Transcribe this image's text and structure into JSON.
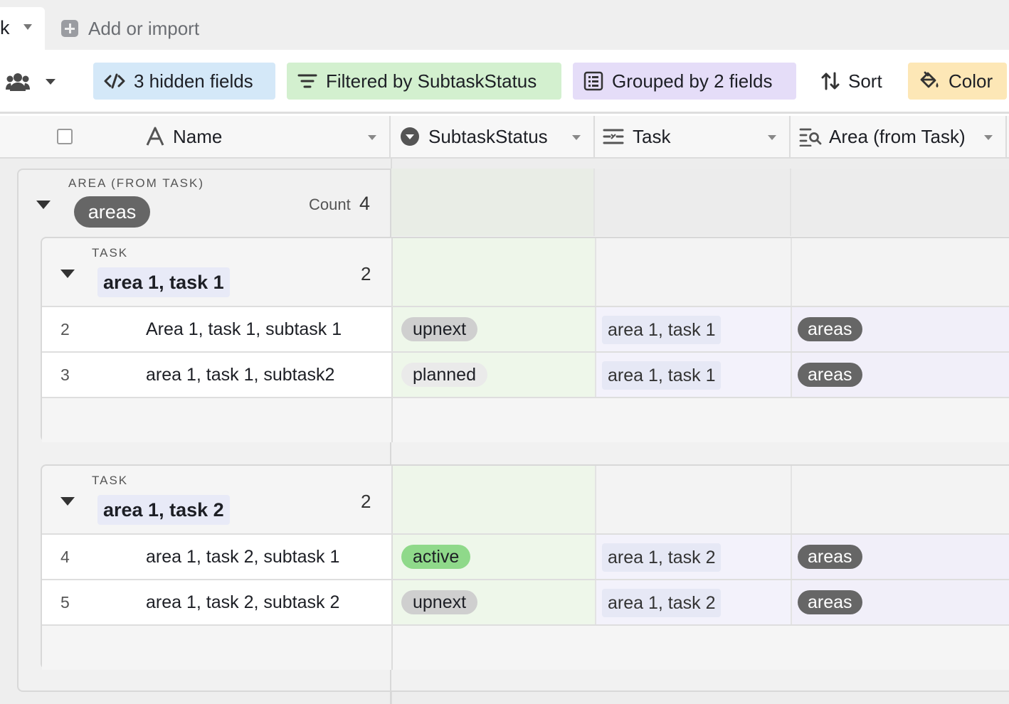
{
  "tabs": {
    "active_label": "k",
    "add_import": "Add or import"
  },
  "toolbar": {
    "hidden_fields": "3 hidden fields",
    "filter": "Filtered by SubtaskStatus",
    "group": "Grouped by 2 fields",
    "sort": "Sort",
    "color": "Color"
  },
  "columns": {
    "name": "Name",
    "status": "SubtaskStatus",
    "task": "Task",
    "area": "Area (from Task)"
  },
  "outer_group": {
    "field_label": "AREA (FROM TASK)",
    "value": "areas",
    "count_label": "Count",
    "count": "4"
  },
  "groups": [
    {
      "field_label": "TASK",
      "value": "area 1, task 1",
      "count": "2",
      "rows": [
        {
          "num": "2",
          "name": "Area 1, task 1, subtask 1",
          "status": "upnext",
          "task": "area 1, task 1",
          "area": "areas"
        },
        {
          "num": "3",
          "name": "area 1, task 1, subtask2",
          "status": "planned",
          "task": "area 1, task 1",
          "area": "areas"
        }
      ]
    },
    {
      "field_label": "TASK",
      "value": "area 1, task 2",
      "count": "2",
      "rows": [
        {
          "num": "4",
          "name": "area 1, task 2, subtask 1",
          "status": "active",
          "task": "area 1, task 2",
          "area": "areas"
        },
        {
          "num": "5",
          "name": "area 1, task 2, subtask 2",
          "status": "upnext",
          "task": "area 1, task 2",
          "area": "areas"
        }
      ]
    }
  ],
  "colors": {
    "upnext": "#cfcfcf",
    "planned": "#eaeaea",
    "active": "#8fd98a"
  }
}
